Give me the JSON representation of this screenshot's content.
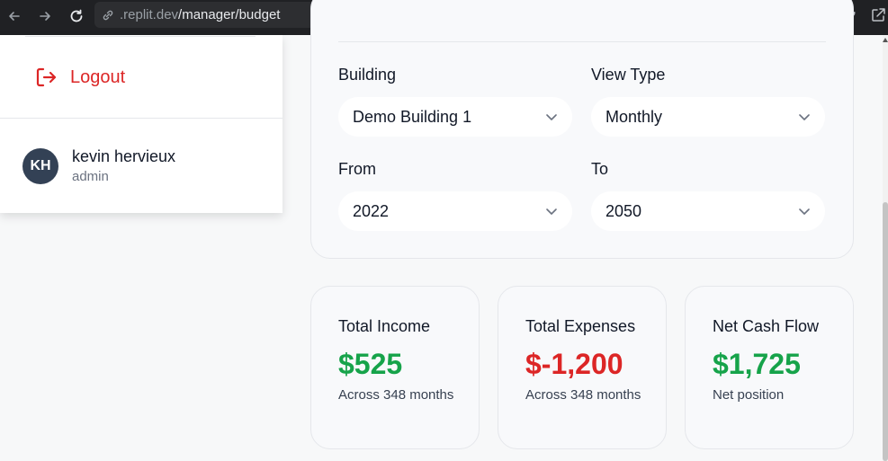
{
  "browser": {
    "url_domain": ".replit.dev",
    "url_path": "/manager/budget"
  },
  "menu": {
    "logout_label": "Logout",
    "user": {
      "initials": "KH",
      "name": "kevin hervieux",
      "role": "admin"
    }
  },
  "filters": {
    "building": {
      "label": "Building",
      "value": "Demo Building 1"
    },
    "view_type": {
      "label": "View Type",
      "value": "Monthly"
    },
    "from": {
      "label": "From",
      "value": "2022"
    },
    "to": {
      "label": "To",
      "value": "2050"
    }
  },
  "stats": [
    {
      "title": "Total Income",
      "value": "$525",
      "subtitle": "Across 348 months",
      "color": "#16a34a"
    },
    {
      "title": "Total Expenses",
      "value": "$-1,200",
      "subtitle": "Across 348 months",
      "color": "#dc2626"
    },
    {
      "title": "Net Cash Flow",
      "value": "$1,725",
      "subtitle": "Net position",
      "color": "#16a34a"
    }
  ],
  "colors": {
    "logout": "#dc2626",
    "avatar_bg": "#334155",
    "positive": "#16a34a",
    "negative": "#dc2626"
  },
  "icons": [
    "back-arrow-icon",
    "forward-arrow-icon",
    "reload-icon",
    "site-info-icon",
    "devices-icon",
    "wrench-icon",
    "open-external-icon",
    "logout-icon",
    "chevron-down-icon"
  ]
}
